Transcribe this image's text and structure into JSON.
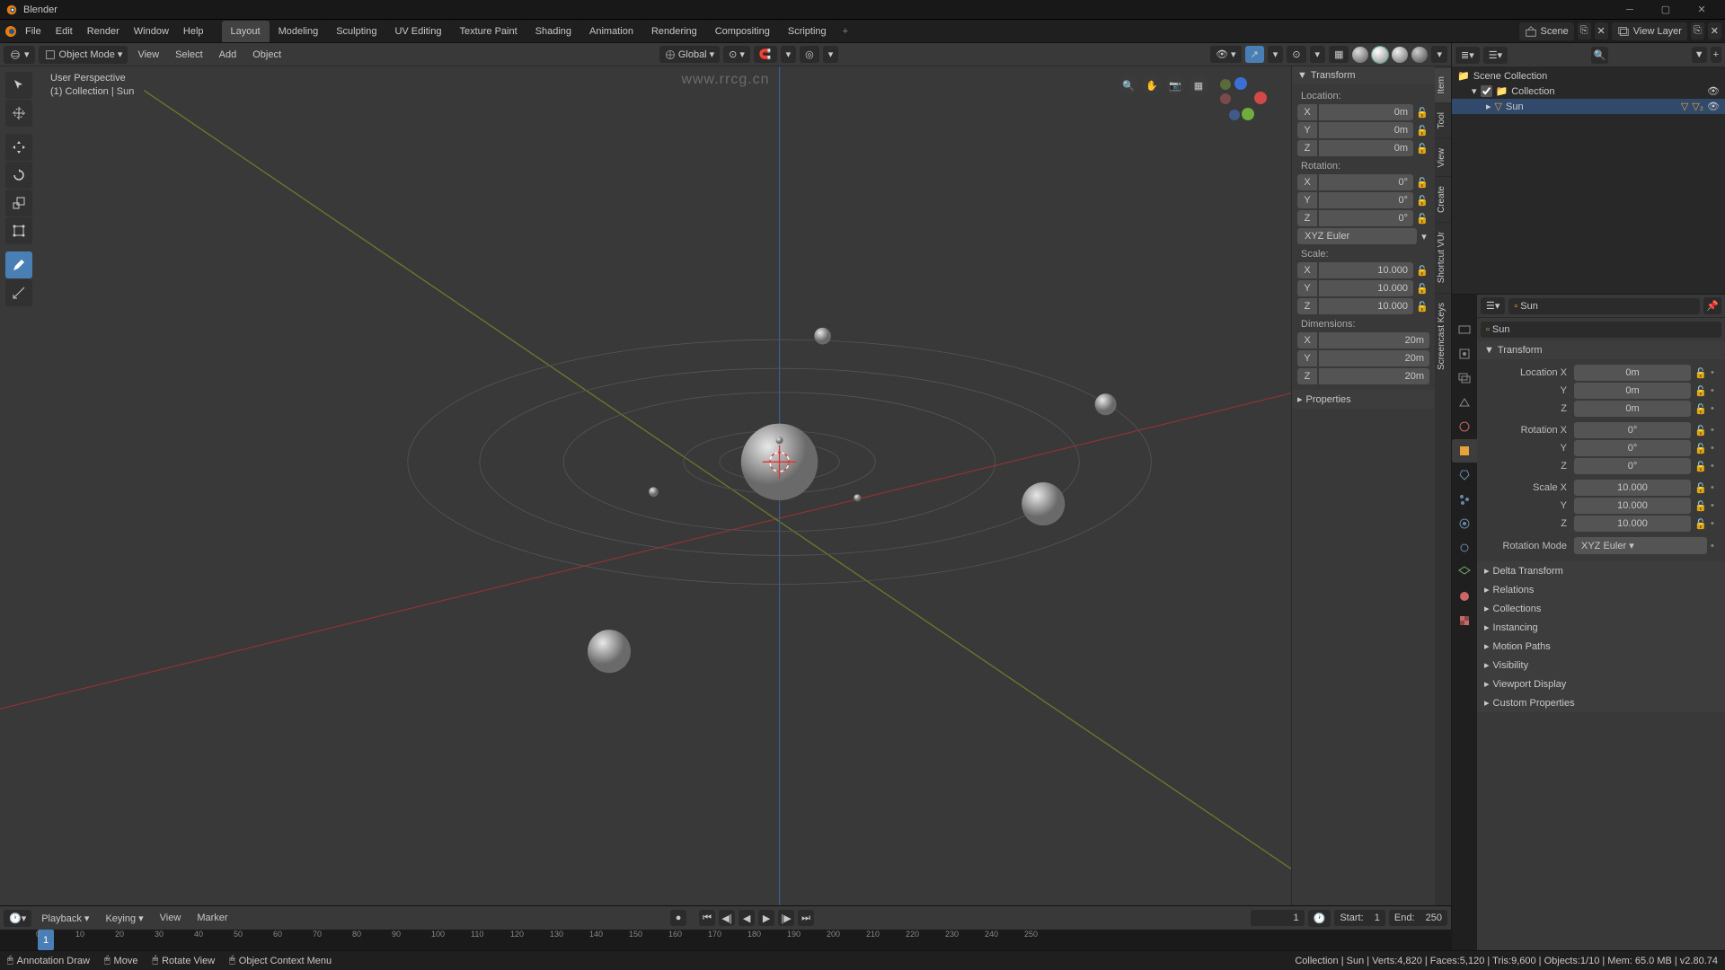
{
  "app": {
    "title": "Blender"
  },
  "watermark_url": "www.rrcg.cn",
  "menus": [
    "File",
    "Edit",
    "Render",
    "Window",
    "Help"
  ],
  "workspaces": [
    "Layout",
    "Modeling",
    "Sculpting",
    "UV Editing",
    "Texture Paint",
    "Shading",
    "Animation",
    "Rendering",
    "Compositing",
    "Scripting"
  ],
  "active_workspace": "Layout",
  "scene_field": {
    "label": "Scene"
  },
  "viewlayer_field": {
    "label": "View Layer"
  },
  "viewport": {
    "mode": "Object Mode",
    "orientation": "Global",
    "menus": [
      "View",
      "Select",
      "Add",
      "Object"
    ],
    "overlay_line1": "User Perspective",
    "overlay_line2": "(1) Collection | Sun"
  },
  "npanel": {
    "tabs": [
      "Item",
      "Tool",
      "View",
      "Create",
      "Shortcut VUr",
      "Screencast Keys"
    ],
    "active_tab": "Item",
    "transform_header": "Transform",
    "location_label": "Location:",
    "rotation_label": "Rotation:",
    "scale_label": "Scale:",
    "dimensions_label": "Dimensions:",
    "location": {
      "x": "0m",
      "y": "0m",
      "z": "0m"
    },
    "rotation": {
      "x": "0°",
      "y": "0°",
      "z": "0°"
    },
    "rotation_mode": "XYZ Euler",
    "scale": {
      "x": "10.000",
      "y": "10.000",
      "z": "10.000"
    },
    "dimensions": {
      "x": "20m",
      "y": "20m",
      "z": "20m"
    },
    "properties_header": "Properties"
  },
  "outliner": {
    "root": "Scene Collection",
    "collection": "Collection",
    "object": "Sun"
  },
  "props": {
    "object_name": "Sun",
    "transform_header": "Transform",
    "labels": {
      "locx": "Location X",
      "y": "Y",
      "z": "Z",
      "rotx": "Rotation X",
      "scalex": "Scale X",
      "rotmode": "Rotation Mode"
    },
    "location": {
      "x": "0m",
      "y": "0m",
      "z": "0m"
    },
    "rotation": {
      "x": "0°",
      "y": "0°",
      "z": "0°"
    },
    "scale": {
      "x": "10.000",
      "y": "10.000",
      "z": "10.000"
    },
    "rotation_mode": "XYZ Euler",
    "sections": [
      "Delta Transform",
      "Relations",
      "Collections",
      "Instancing",
      "Motion Paths",
      "Visibility",
      "Viewport Display",
      "Custom Properties"
    ]
  },
  "timeline": {
    "menus": [
      "Playback",
      "Keying",
      "View",
      "Marker"
    ],
    "current": "1",
    "start_label": "Start:",
    "start": "1",
    "end_label": "End:",
    "end": "250",
    "ticks": [
      "0",
      "10",
      "20",
      "30",
      "40",
      "50",
      "60",
      "70",
      "80",
      "90",
      "100",
      "110",
      "120",
      "130",
      "140",
      "150",
      "160",
      "170",
      "180",
      "190",
      "200",
      "210",
      "220",
      "230",
      "240",
      "250"
    ]
  },
  "statusbar": {
    "left": [
      "Annotation Draw",
      "Move",
      "Rotate View",
      "Object Context Menu"
    ],
    "right": "Collection | Sun | Verts:4,820 | Faces:5,120 | Tris:9,600 | Objects:1/10 | Mem: 65.0 MB | v2.80.74"
  }
}
